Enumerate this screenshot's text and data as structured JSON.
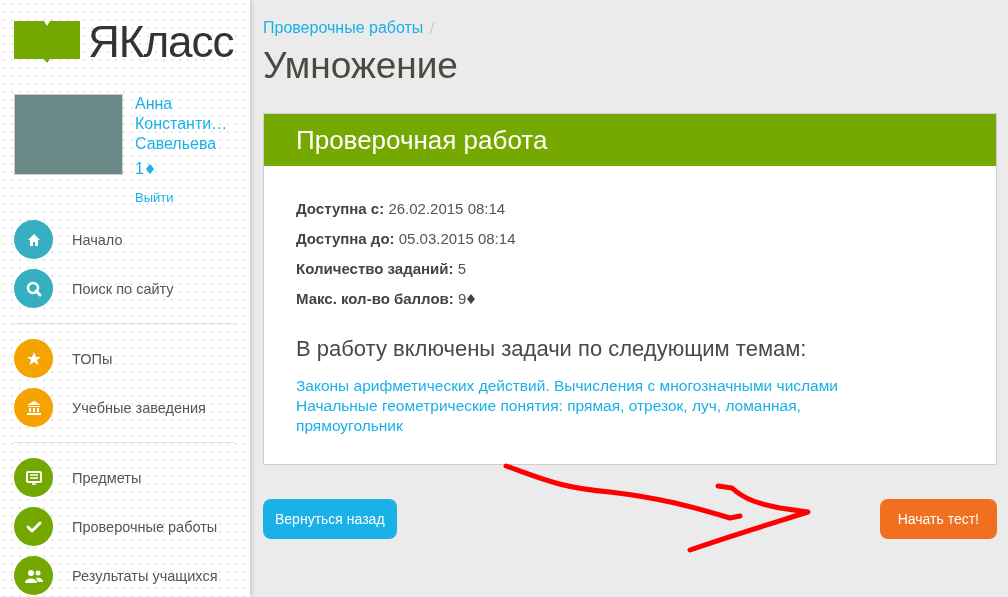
{
  "logo": {
    "text": "ЯКласс"
  },
  "user": {
    "name_lines": [
      "Анна",
      "Константи…",
      "Савельева"
    ],
    "points": "1",
    "logout": "Выйти"
  },
  "menu": [
    {
      "items": [
        {
          "label": "Начало",
          "color": "#36b0c0"
        },
        {
          "label": "Поиск по сайту",
          "color": "#36b0c0"
        }
      ]
    },
    {
      "items": [
        {
          "label": "ТОПы",
          "color": "#f5a300"
        },
        {
          "label": "Учебные заведения",
          "color": "#f5a300"
        }
      ]
    },
    {
      "items": [
        {
          "label": "Предметы",
          "color": "#72a800"
        },
        {
          "label": "Проверочные работы",
          "color": "#72a800"
        },
        {
          "label": "Результаты учащихся",
          "color": "#72a800"
        }
      ]
    }
  ],
  "breadcrumb": [
    "Проверочные работы"
  ],
  "page_title": "Умножение",
  "card": {
    "title": "Проверочная работа",
    "details": [
      {
        "label": "Доступна с:",
        "value": "26.02.2015 08:14",
        "point_icon": false
      },
      {
        "label": "Доступна до:",
        "value": "05.03.2015 08:14",
        "point_icon": false
      },
      {
        "label": "Количество заданий:",
        "value": "5",
        "point_icon": false
      },
      {
        "label": "Макс. кол-во баллов:",
        "value": "9",
        "point_icon": true
      }
    ],
    "topics_heading": "В работу включены задачи по следующим темам:",
    "topics": [
      "Законы арифметических действий. Вычисления с многозначными числами",
      "Начальные геометрические понятия: прямая, отрезок, луч, ломанная, прямоугольник"
    ]
  },
  "buttons": [
    {
      "label": "Вернуться назад",
      "kind": "back"
    },
    {
      "label": "Начать тест!",
      "kind": "start"
    }
  ]
}
